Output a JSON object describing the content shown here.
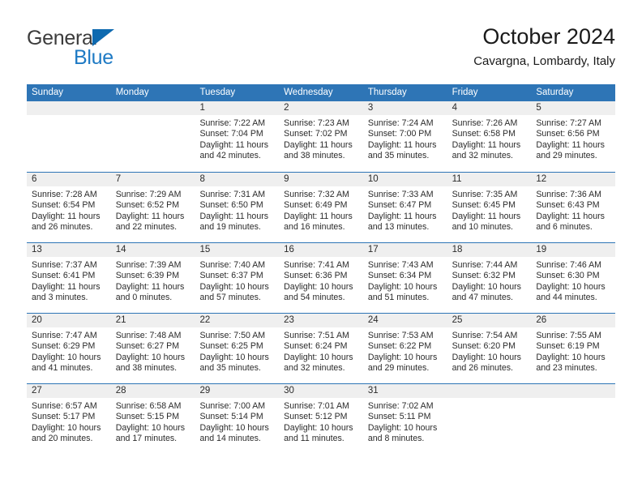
{
  "brand": {
    "name_top": "General",
    "name_bottom": "Blue",
    "triangle_color": "#0E6AB0",
    "text_color": "#3C3C3C",
    "blue_color": "#1E7AC4"
  },
  "header": {
    "title": "October 2024",
    "location": "Cavargna, Lombardy, Italy"
  },
  "calendar": {
    "accent_color": "#2E75B6",
    "daynum_band_color": "#EFEFEF",
    "weekday_headers": [
      "Sunday",
      "Monday",
      "Tuesday",
      "Wednesday",
      "Thursday",
      "Friday",
      "Saturday"
    ],
    "weeks": [
      [
        {
          "day": "",
          "sunrise": "",
          "sunset": "",
          "daylight_line1": "",
          "daylight_line2": "",
          "empty": true
        },
        {
          "day": "",
          "sunrise": "",
          "sunset": "",
          "daylight_line1": "",
          "daylight_line2": "",
          "empty": true
        },
        {
          "day": "1",
          "sunrise": "Sunrise: 7:22 AM",
          "sunset": "Sunset: 7:04 PM",
          "daylight_line1": "Daylight: 11 hours",
          "daylight_line2": "and 42 minutes."
        },
        {
          "day": "2",
          "sunrise": "Sunrise: 7:23 AM",
          "sunset": "Sunset: 7:02 PM",
          "daylight_line1": "Daylight: 11 hours",
          "daylight_line2": "and 38 minutes."
        },
        {
          "day": "3",
          "sunrise": "Sunrise: 7:24 AM",
          "sunset": "Sunset: 7:00 PM",
          "daylight_line1": "Daylight: 11 hours",
          "daylight_line2": "and 35 minutes."
        },
        {
          "day": "4",
          "sunrise": "Sunrise: 7:26 AM",
          "sunset": "Sunset: 6:58 PM",
          "daylight_line1": "Daylight: 11 hours",
          "daylight_line2": "and 32 minutes."
        },
        {
          "day": "5",
          "sunrise": "Sunrise: 7:27 AM",
          "sunset": "Sunset: 6:56 PM",
          "daylight_line1": "Daylight: 11 hours",
          "daylight_line2": "and 29 minutes."
        }
      ],
      [
        {
          "day": "6",
          "sunrise": "Sunrise: 7:28 AM",
          "sunset": "Sunset: 6:54 PM",
          "daylight_line1": "Daylight: 11 hours",
          "daylight_line2": "and 26 minutes."
        },
        {
          "day": "7",
          "sunrise": "Sunrise: 7:29 AM",
          "sunset": "Sunset: 6:52 PM",
          "daylight_line1": "Daylight: 11 hours",
          "daylight_line2": "and 22 minutes."
        },
        {
          "day": "8",
          "sunrise": "Sunrise: 7:31 AM",
          "sunset": "Sunset: 6:50 PM",
          "daylight_line1": "Daylight: 11 hours",
          "daylight_line2": "and 19 minutes."
        },
        {
          "day": "9",
          "sunrise": "Sunrise: 7:32 AM",
          "sunset": "Sunset: 6:49 PM",
          "daylight_line1": "Daylight: 11 hours",
          "daylight_line2": "and 16 minutes."
        },
        {
          "day": "10",
          "sunrise": "Sunrise: 7:33 AM",
          "sunset": "Sunset: 6:47 PM",
          "daylight_line1": "Daylight: 11 hours",
          "daylight_line2": "and 13 minutes."
        },
        {
          "day": "11",
          "sunrise": "Sunrise: 7:35 AM",
          "sunset": "Sunset: 6:45 PM",
          "daylight_line1": "Daylight: 11 hours",
          "daylight_line2": "and 10 minutes."
        },
        {
          "day": "12",
          "sunrise": "Sunrise: 7:36 AM",
          "sunset": "Sunset: 6:43 PM",
          "daylight_line1": "Daylight: 11 hours",
          "daylight_line2": "and 6 minutes."
        }
      ],
      [
        {
          "day": "13",
          "sunrise": "Sunrise: 7:37 AM",
          "sunset": "Sunset: 6:41 PM",
          "daylight_line1": "Daylight: 11 hours",
          "daylight_line2": "and 3 minutes."
        },
        {
          "day": "14",
          "sunrise": "Sunrise: 7:39 AM",
          "sunset": "Sunset: 6:39 PM",
          "daylight_line1": "Daylight: 11 hours",
          "daylight_line2": "and 0 minutes."
        },
        {
          "day": "15",
          "sunrise": "Sunrise: 7:40 AM",
          "sunset": "Sunset: 6:37 PM",
          "daylight_line1": "Daylight: 10 hours",
          "daylight_line2": "and 57 minutes."
        },
        {
          "day": "16",
          "sunrise": "Sunrise: 7:41 AM",
          "sunset": "Sunset: 6:36 PM",
          "daylight_line1": "Daylight: 10 hours",
          "daylight_line2": "and 54 minutes."
        },
        {
          "day": "17",
          "sunrise": "Sunrise: 7:43 AM",
          "sunset": "Sunset: 6:34 PM",
          "daylight_line1": "Daylight: 10 hours",
          "daylight_line2": "and 51 minutes."
        },
        {
          "day": "18",
          "sunrise": "Sunrise: 7:44 AM",
          "sunset": "Sunset: 6:32 PM",
          "daylight_line1": "Daylight: 10 hours",
          "daylight_line2": "and 47 minutes."
        },
        {
          "day": "19",
          "sunrise": "Sunrise: 7:46 AM",
          "sunset": "Sunset: 6:30 PM",
          "daylight_line1": "Daylight: 10 hours",
          "daylight_line2": "and 44 minutes."
        }
      ],
      [
        {
          "day": "20",
          "sunrise": "Sunrise: 7:47 AM",
          "sunset": "Sunset: 6:29 PM",
          "daylight_line1": "Daylight: 10 hours",
          "daylight_line2": "and 41 minutes."
        },
        {
          "day": "21",
          "sunrise": "Sunrise: 7:48 AM",
          "sunset": "Sunset: 6:27 PM",
          "daylight_line1": "Daylight: 10 hours",
          "daylight_line2": "and 38 minutes."
        },
        {
          "day": "22",
          "sunrise": "Sunrise: 7:50 AM",
          "sunset": "Sunset: 6:25 PM",
          "daylight_line1": "Daylight: 10 hours",
          "daylight_line2": "and 35 minutes."
        },
        {
          "day": "23",
          "sunrise": "Sunrise: 7:51 AM",
          "sunset": "Sunset: 6:24 PM",
          "daylight_line1": "Daylight: 10 hours",
          "daylight_line2": "and 32 minutes."
        },
        {
          "day": "24",
          "sunrise": "Sunrise: 7:53 AM",
          "sunset": "Sunset: 6:22 PM",
          "daylight_line1": "Daylight: 10 hours",
          "daylight_line2": "and 29 minutes."
        },
        {
          "day": "25",
          "sunrise": "Sunrise: 7:54 AM",
          "sunset": "Sunset: 6:20 PM",
          "daylight_line1": "Daylight: 10 hours",
          "daylight_line2": "and 26 minutes."
        },
        {
          "day": "26",
          "sunrise": "Sunrise: 7:55 AM",
          "sunset": "Sunset: 6:19 PM",
          "daylight_line1": "Daylight: 10 hours",
          "daylight_line2": "and 23 minutes."
        }
      ],
      [
        {
          "day": "27",
          "sunrise": "Sunrise: 6:57 AM",
          "sunset": "Sunset: 5:17 PM",
          "daylight_line1": "Daylight: 10 hours",
          "daylight_line2": "and 20 minutes."
        },
        {
          "day": "28",
          "sunrise": "Sunrise: 6:58 AM",
          "sunset": "Sunset: 5:15 PM",
          "daylight_line1": "Daylight: 10 hours",
          "daylight_line2": "and 17 minutes."
        },
        {
          "day": "29",
          "sunrise": "Sunrise: 7:00 AM",
          "sunset": "Sunset: 5:14 PM",
          "daylight_line1": "Daylight: 10 hours",
          "daylight_line2": "and 14 minutes."
        },
        {
          "day": "30",
          "sunrise": "Sunrise: 7:01 AM",
          "sunset": "Sunset: 5:12 PM",
          "daylight_line1": "Daylight: 10 hours",
          "daylight_line2": "and 11 minutes."
        },
        {
          "day": "31",
          "sunrise": "Sunrise: 7:02 AM",
          "sunset": "Sunset: 5:11 PM",
          "daylight_line1": "Daylight: 10 hours",
          "daylight_line2": "and 8 minutes."
        },
        {
          "day": "",
          "sunrise": "",
          "sunset": "",
          "daylight_line1": "",
          "daylight_line2": "",
          "empty": true
        },
        {
          "day": "",
          "sunrise": "",
          "sunset": "",
          "daylight_line1": "",
          "daylight_line2": "",
          "empty": true
        }
      ]
    ]
  }
}
